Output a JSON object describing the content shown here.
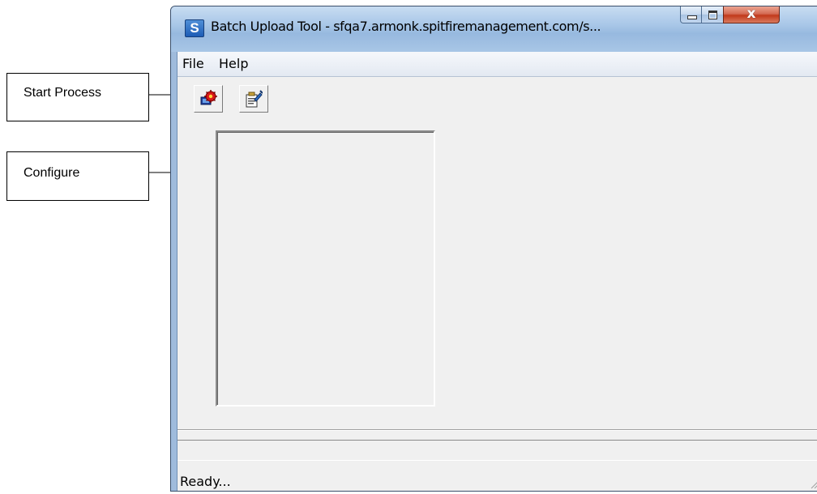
{
  "callouts": {
    "start_process": "Start Process",
    "configure": "Configure"
  },
  "window": {
    "title": "Batch Upload Tool - sfqa7.armonk.spitfiremanagement.com/s...",
    "app_icon_letter": "S"
  },
  "menu": {
    "file": "File",
    "help": "Help"
  },
  "toolbar": {
    "start_icon": "start-process-icon",
    "configure_icon": "configure-icon"
  },
  "status": {
    "text": "Ready..."
  }
}
